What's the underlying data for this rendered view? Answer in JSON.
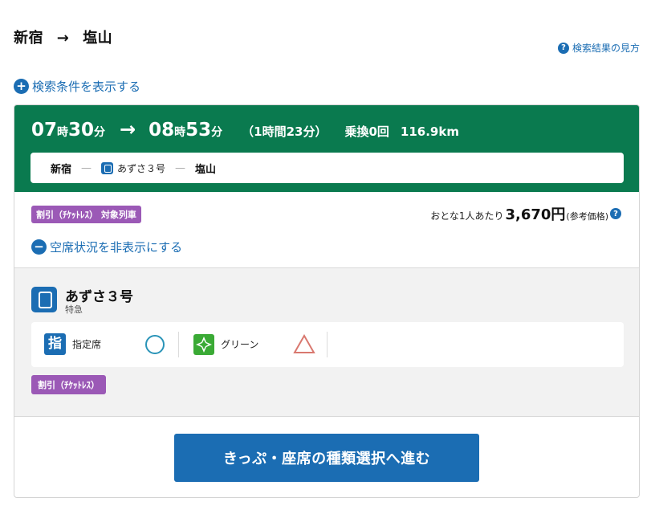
{
  "route": {
    "from": "新宿",
    "arrow": "→",
    "to": "塩山"
  },
  "help_link": {
    "icon_text": "?",
    "label": "検索結果の見方"
  },
  "search_conditions_toggle": {
    "icon_text": "+",
    "label": "検索条件を表示する"
  },
  "result": {
    "depart_hour": "07",
    "depart_hour_unit": "時",
    "depart_min": "30",
    "depart_min_unit": "分",
    "arrow": "→",
    "arrive_hour": "08",
    "arrive_hour_unit": "時",
    "arrive_min": "53",
    "arrive_min_unit": "分",
    "duration": "（1時間23分）",
    "transfers": "乗換0回",
    "distance": "116.9km",
    "route_bar": {
      "from": "新宿",
      "separator": "—",
      "train": "あずさ３号",
      "to": "塩山"
    },
    "discount_badge": "割引（ﾁｹｯﾄﾚｽ） 対象列車",
    "fare": {
      "label": "おとな1人あたり",
      "amount": "3,670円",
      "note": "(参考価格)",
      "help_icon_text": "?"
    },
    "seat_toggle": {
      "icon_text": "−",
      "label": "空席状況を非表示にする"
    },
    "train": {
      "name": "あずさ３号",
      "type": "特急",
      "seats": [
        {
          "icon_text": "指",
          "label": "指定席",
          "availability": "circle"
        },
        {
          "label": "グリーン",
          "availability": "triangle"
        }
      ],
      "discount_badge": "割引（ﾁｹｯﾄﾚｽ）"
    },
    "cta_label": "きっぷ・座席の種類選択へ進む"
  },
  "colors": {
    "header_green": "#0a7a4f",
    "accent_blue": "#1b6db3",
    "badge_purple": "#9b59b6",
    "circle_teal": "#2a94b8",
    "triangle_red": "#d9786f",
    "green_seat": "#3aaa35"
  }
}
